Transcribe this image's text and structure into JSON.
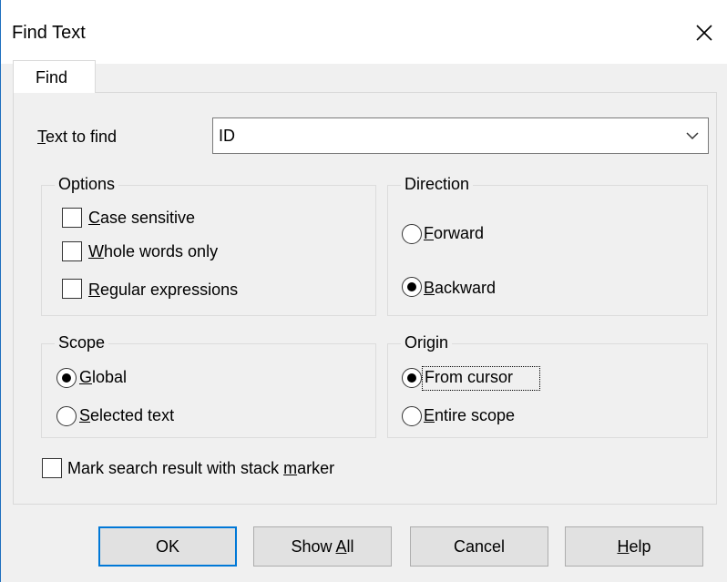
{
  "window": {
    "title": "Find Text"
  },
  "tabs": [
    {
      "label": "Find"
    }
  ],
  "find": {
    "text_to_find_prefix": "T",
    "text_to_find_rest": "ext to find",
    "value": "ID"
  },
  "options": {
    "legend": "Options",
    "items": [
      {
        "u": "C",
        "rest": "ase sensitive",
        "checked": false
      },
      {
        "u": "W",
        "rest": "hole words only",
        "checked": false
      },
      {
        "u": "R",
        "rest": "egular expressions",
        "checked": false
      }
    ]
  },
  "direction": {
    "legend": "Direction",
    "items": [
      {
        "u": "F",
        "rest": "orward",
        "selected": false
      },
      {
        "u": "B",
        "rest": "ackward",
        "selected": true
      }
    ]
  },
  "scope": {
    "legend": "Scope",
    "items": [
      {
        "u": "G",
        "rest": "lobal",
        "selected": true
      },
      {
        "u": "S",
        "rest": "elected text",
        "selected": false
      }
    ]
  },
  "origin": {
    "legend": "Origin",
    "items": [
      {
        "u": "",
        "full": "From cursor",
        "selected": true
      },
      {
        "u": "E",
        "rest": "ntire scope",
        "selected": false
      }
    ]
  },
  "mark": {
    "pre": "Mark search result with stack ",
    "u": "m",
    "rest": "arker",
    "checked": false
  },
  "buttons": {
    "ok": "OK",
    "show_all_pre": "Show ",
    "show_all_u": "A",
    "show_all_rest": "ll",
    "cancel": "Cancel",
    "help_u": "H",
    "help_rest": "elp"
  }
}
